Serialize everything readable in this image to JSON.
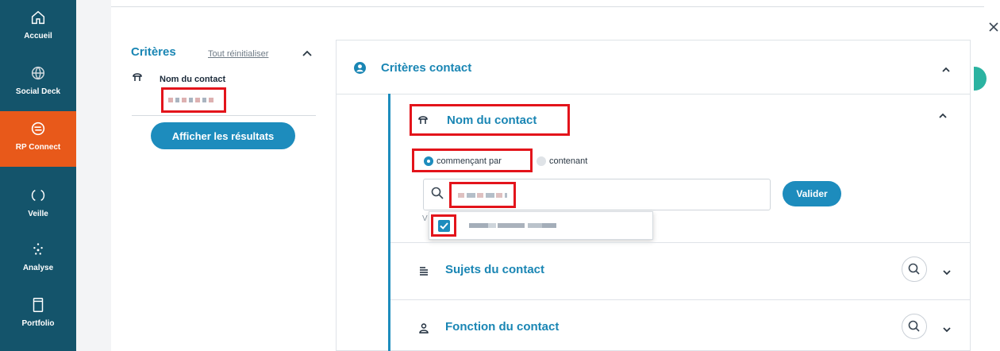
{
  "nav": {
    "items": [
      {
        "label": "Accueil",
        "icon": "home-icon"
      },
      {
        "label": "Social Deck",
        "icon": "globe-icon"
      },
      {
        "label": "RP Connect",
        "icon": "rp-connect-icon",
        "active": true
      },
      {
        "label": "Veille",
        "icon": "loop-icon"
      },
      {
        "label": "Analyse",
        "icon": "dots-icon"
      },
      {
        "label": "Portfolio",
        "icon": "portfolio-icon"
      }
    ]
  },
  "criteria": {
    "title": "Critères",
    "reset_label": "Tout réinitialiser",
    "item_label": "Nom du contact",
    "show_results_label": "Afficher les résultats"
  },
  "main": {
    "title": "Critères contact",
    "name_section": {
      "title": "Nom du contact",
      "radio_starts_with": "commençant par",
      "radio_contains": "contenant",
      "validate_label": "Valider",
      "hint": "V"
    },
    "subjects_section": {
      "title": "Sujets du contact"
    },
    "function_section": {
      "title": "Fonction du contact"
    }
  },
  "colors": {
    "nav_bg": "#14546b",
    "nav_active": "#e8591a",
    "accent": "#1d8cbd",
    "highlight": "#e3141b",
    "teal": "#2bb3a1"
  }
}
